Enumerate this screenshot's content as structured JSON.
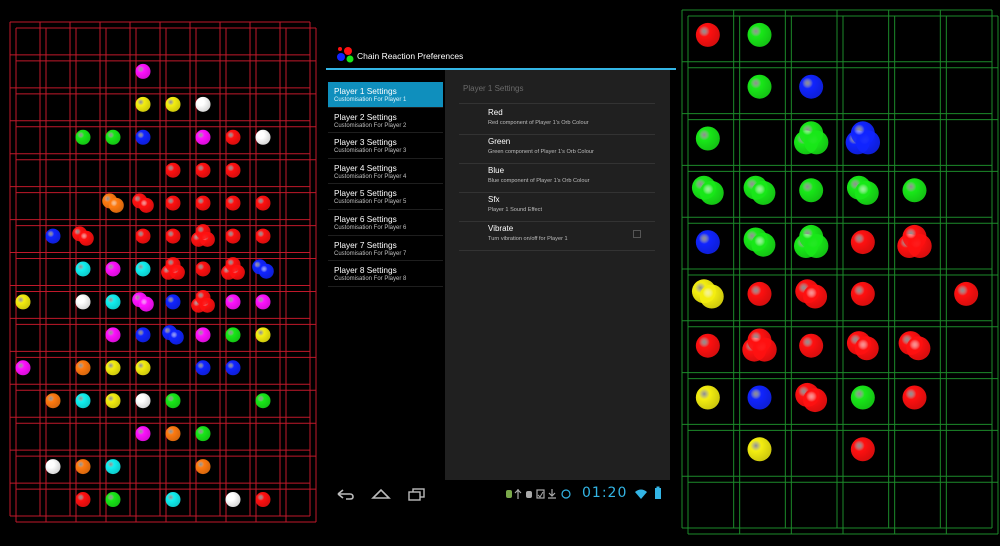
{
  "app": {
    "title": "Chain Reaction Preferences",
    "accent_color": "#33b5e5"
  },
  "left_list": {
    "items": [
      {
        "title": "Player 1 Settings",
        "subtitle": "Customisation For Player 1",
        "selected": true
      },
      {
        "title": "Player 2 Settings",
        "subtitle": "Customisation For Player 2",
        "selected": false
      },
      {
        "title": "Player 3 Settings",
        "subtitle": "Customisation For Player 3",
        "selected": false
      },
      {
        "title": "Player 4 Settings",
        "subtitle": "Customisation For Player 4",
        "selected": false
      },
      {
        "title": "Player 5 Settings",
        "subtitle": "Customisation For Player 5",
        "selected": false
      },
      {
        "title": "Player 6 Settings",
        "subtitle": "Customisation For Player 6",
        "selected": false
      },
      {
        "title": "Player 7 Settings",
        "subtitle": "Customisation For Player 7",
        "selected": false
      },
      {
        "title": "Player 8 Settings",
        "subtitle": "Customisation For Player 8",
        "selected": false
      }
    ]
  },
  "pref_panel": {
    "header": "Player 1 Settings",
    "items": [
      {
        "title": "Red",
        "subtitle": "Red component of Player 1's Orb Colour"
      },
      {
        "title": "Green",
        "subtitle": "Green component of Player 1's Orb Colour"
      },
      {
        "title": "Blue",
        "subtitle": "Blue component of Player 1's Orb Colour"
      },
      {
        "title": "Sfx",
        "subtitle": "Player 1 Sound Effect"
      },
      {
        "title": "Vibrate",
        "subtitle": "Turn vibration on/off for Player 1",
        "checked": false
      }
    ]
  },
  "status_bar": {
    "time": "01:20",
    "icons": [
      "android-icon",
      "usb-icon",
      "debug-icon",
      "notification-icon",
      "download-icon",
      "alarm-icon",
      "wifi-icon",
      "battery-icon"
    ]
  },
  "nav_bar": {
    "buttons": [
      "back-icon",
      "home-icon",
      "recent-apps-icon"
    ]
  },
  "boards": {
    "left": {
      "grid_color": "#c0182a",
      "cols": 10,
      "rows": 15,
      "orbs": [
        {
          "c": 4,
          "r": 1,
          "color": "magenta",
          "n": 1
        },
        {
          "c": 4,
          "r": 2,
          "color": "yellow",
          "n": 1
        },
        {
          "c": 5,
          "r": 2,
          "color": "yellow",
          "n": 1
        },
        {
          "c": 6,
          "r": 2,
          "color": "white",
          "n": 1
        },
        {
          "c": 2,
          "r": 3,
          "color": "green",
          "n": 1
        },
        {
          "c": 3,
          "r": 3,
          "color": "green",
          "n": 1
        },
        {
          "c": 4,
          "r": 3,
          "color": "blue",
          "n": 1
        },
        {
          "c": 6,
          "r": 3,
          "color": "magenta",
          "n": 1
        },
        {
          "c": 7,
          "r": 3,
          "color": "red",
          "n": 1
        },
        {
          "c": 8,
          "r": 3,
          "color": "white",
          "n": 1
        },
        {
          "c": 5,
          "r": 4,
          "color": "red",
          "n": 1
        },
        {
          "c": 6,
          "r": 4,
          "color": "red",
          "n": 1
        },
        {
          "c": 7,
          "r": 4,
          "color": "red",
          "n": 1
        },
        {
          "c": 3,
          "r": 5,
          "color": "orange",
          "n": 2
        },
        {
          "c": 4,
          "r": 5,
          "color": "red",
          "n": 2
        },
        {
          "c": 5,
          "r": 5,
          "color": "red",
          "n": 1
        },
        {
          "c": 6,
          "r": 5,
          "color": "red",
          "n": 1
        },
        {
          "c": 7,
          "r": 5,
          "color": "red",
          "n": 1
        },
        {
          "c": 8,
          "r": 5,
          "color": "red",
          "n": 1
        },
        {
          "c": 1,
          "r": 6,
          "color": "blue",
          "n": 1
        },
        {
          "c": 2,
          "r": 6,
          "color": "red",
          "n": 2
        },
        {
          "c": 4,
          "r": 6,
          "color": "red",
          "n": 1
        },
        {
          "c": 5,
          "r": 6,
          "color": "red",
          "n": 1
        },
        {
          "c": 6,
          "r": 6,
          "color": "red",
          "n": 3
        },
        {
          "c": 7,
          "r": 6,
          "color": "red",
          "n": 1
        },
        {
          "c": 8,
          "r": 6,
          "color": "red",
          "n": 1
        },
        {
          "c": 2,
          "r": 7,
          "color": "cyan",
          "n": 1
        },
        {
          "c": 3,
          "r": 7,
          "color": "magenta",
          "n": 1
        },
        {
          "c": 4,
          "r": 7,
          "color": "cyan",
          "n": 1
        },
        {
          "c": 5,
          "r": 7,
          "color": "red",
          "n": 3
        },
        {
          "c": 6,
          "r": 7,
          "color": "red",
          "n": 1
        },
        {
          "c": 7,
          "r": 7,
          "color": "red",
          "n": 3
        },
        {
          "c": 8,
          "r": 7,
          "color": "blue",
          "n": 2
        },
        {
          "c": 0,
          "r": 8,
          "color": "yellow",
          "n": 1
        },
        {
          "c": 2,
          "r": 8,
          "color": "white",
          "n": 1
        },
        {
          "c": 3,
          "r": 8,
          "color": "cyan",
          "n": 1
        },
        {
          "c": 4,
          "r": 8,
          "color": "magenta",
          "n": 2
        },
        {
          "c": 5,
          "r": 8,
          "color": "blue",
          "n": 1
        },
        {
          "c": 6,
          "r": 8,
          "color": "red",
          "n": 3
        },
        {
          "c": 7,
          "r": 8,
          "color": "magenta",
          "n": 1
        },
        {
          "c": 8,
          "r": 8,
          "color": "magenta",
          "n": 1
        },
        {
          "c": 3,
          "r": 9,
          "color": "magenta",
          "n": 1
        },
        {
          "c": 4,
          "r": 9,
          "color": "blue",
          "n": 1
        },
        {
          "c": 5,
          "r": 9,
          "color": "blue",
          "n": 2
        },
        {
          "c": 6,
          "r": 9,
          "color": "magenta",
          "n": 1
        },
        {
          "c": 7,
          "r": 9,
          "color": "green",
          "n": 1
        },
        {
          "c": 8,
          "r": 9,
          "color": "yellow",
          "n": 1
        },
        {
          "c": 0,
          "r": 10,
          "color": "magenta",
          "n": 1
        },
        {
          "c": 2,
          "r": 10,
          "color": "orange",
          "n": 1
        },
        {
          "c": 3,
          "r": 10,
          "color": "yellow",
          "n": 1
        },
        {
          "c": 4,
          "r": 10,
          "color": "yellow",
          "n": 1
        },
        {
          "c": 6,
          "r": 10,
          "color": "blue",
          "n": 1
        },
        {
          "c": 7,
          "r": 10,
          "color": "blue",
          "n": 1
        },
        {
          "c": 1,
          "r": 11,
          "color": "orange",
          "n": 1
        },
        {
          "c": 2,
          "r": 11,
          "color": "cyan",
          "n": 1
        },
        {
          "c": 3,
          "r": 11,
          "color": "yellow",
          "n": 1
        },
        {
          "c": 4,
          "r": 11,
          "color": "white",
          "n": 1
        },
        {
          "c": 5,
          "r": 11,
          "color": "green",
          "n": 1
        },
        {
          "c": 8,
          "r": 11,
          "color": "green",
          "n": 1
        },
        {
          "c": 4,
          "r": 12,
          "color": "magenta",
          "n": 1
        },
        {
          "c": 5,
          "r": 12,
          "color": "orange",
          "n": 1
        },
        {
          "c": 6,
          "r": 12,
          "color": "green",
          "n": 1
        },
        {
          "c": 1,
          "r": 13,
          "color": "white",
          "n": 1
        },
        {
          "c": 2,
          "r": 13,
          "color": "orange",
          "n": 1
        },
        {
          "c": 3,
          "r": 13,
          "color": "cyan",
          "n": 1
        },
        {
          "c": 6,
          "r": 13,
          "color": "orange",
          "n": 1
        },
        {
          "c": 2,
          "r": 14,
          "color": "red",
          "n": 1
        },
        {
          "c": 3,
          "r": 14,
          "color": "green",
          "n": 1
        },
        {
          "c": 5,
          "r": 14,
          "color": "cyan",
          "n": 1
        },
        {
          "c": 7,
          "r": 14,
          "color": "white",
          "n": 1
        },
        {
          "c": 8,
          "r": 14,
          "color": "red",
          "n": 1
        }
      ]
    },
    "right": {
      "grid_color": "#1c8a2a",
      "cols": 6,
      "rows": 10,
      "orbs": [
        {
          "c": 0,
          "r": 0,
          "color": "red",
          "n": 1
        },
        {
          "c": 1,
          "r": 0,
          "color": "green",
          "n": 1
        },
        {
          "c": 1,
          "r": 1,
          "color": "green",
          "n": 1
        },
        {
          "c": 2,
          "r": 1,
          "color": "blue",
          "n": 1
        },
        {
          "c": 0,
          "r": 2,
          "color": "green",
          "n": 1
        },
        {
          "c": 2,
          "r": 2,
          "color": "green",
          "n": 3
        },
        {
          "c": 3,
          "r": 2,
          "color": "blue",
          "n": 3
        },
        {
          "c": 0,
          "r": 3,
          "color": "green",
          "n": 2
        },
        {
          "c": 1,
          "r": 3,
          "color": "green",
          "n": 2
        },
        {
          "c": 2,
          "r": 3,
          "color": "green",
          "n": 1
        },
        {
          "c": 3,
          "r": 3,
          "color": "green",
          "n": 2
        },
        {
          "c": 4,
          "r": 3,
          "color": "green",
          "n": 1
        },
        {
          "c": 0,
          "r": 4,
          "color": "blue",
          "n": 1
        },
        {
          "c": 1,
          "r": 4,
          "color": "green",
          "n": 2
        },
        {
          "c": 2,
          "r": 4,
          "color": "green",
          "n": 3
        },
        {
          "c": 3,
          "r": 4,
          "color": "red",
          "n": 1
        },
        {
          "c": 4,
          "r": 4,
          "color": "red",
          "n": 3
        },
        {
          "c": 0,
          "r": 5,
          "color": "yellow",
          "n": 2
        },
        {
          "c": 1,
          "r": 5,
          "color": "red",
          "n": 1
        },
        {
          "c": 2,
          "r": 5,
          "color": "red",
          "n": 2
        },
        {
          "c": 3,
          "r": 5,
          "color": "red",
          "n": 1
        },
        {
          "c": 5,
          "r": 5,
          "color": "red",
          "n": 1
        },
        {
          "c": 0,
          "r": 6,
          "color": "red",
          "n": 1
        },
        {
          "c": 1,
          "r": 6,
          "color": "red",
          "n": 3
        },
        {
          "c": 2,
          "r": 6,
          "color": "red",
          "n": 1
        },
        {
          "c": 3,
          "r": 6,
          "color": "red",
          "n": 2
        },
        {
          "c": 4,
          "r": 6,
          "color": "red",
          "n": 2
        },
        {
          "c": 0,
          "r": 7,
          "color": "yellow",
          "n": 1
        },
        {
          "c": 1,
          "r": 7,
          "color": "blue",
          "n": 1
        },
        {
          "c": 2,
          "r": 7,
          "color": "red",
          "n": 2
        },
        {
          "c": 3,
          "r": 7,
          "color": "green",
          "n": 1
        },
        {
          "c": 4,
          "r": 7,
          "color": "red",
          "n": 1
        },
        {
          "c": 1,
          "r": 8,
          "color": "yellow",
          "n": 1
        },
        {
          "c": 3,
          "r": 8,
          "color": "red",
          "n": 1
        }
      ]
    }
  },
  "orb_colors": {
    "red": "#ff1010",
    "green": "#18e818",
    "blue": "#1024ff",
    "yellow": "#f4ee10",
    "magenta": "#ff10ff",
    "cyan": "#10f0f0",
    "white": "#ffffff",
    "orange": "#ff7a10"
  }
}
